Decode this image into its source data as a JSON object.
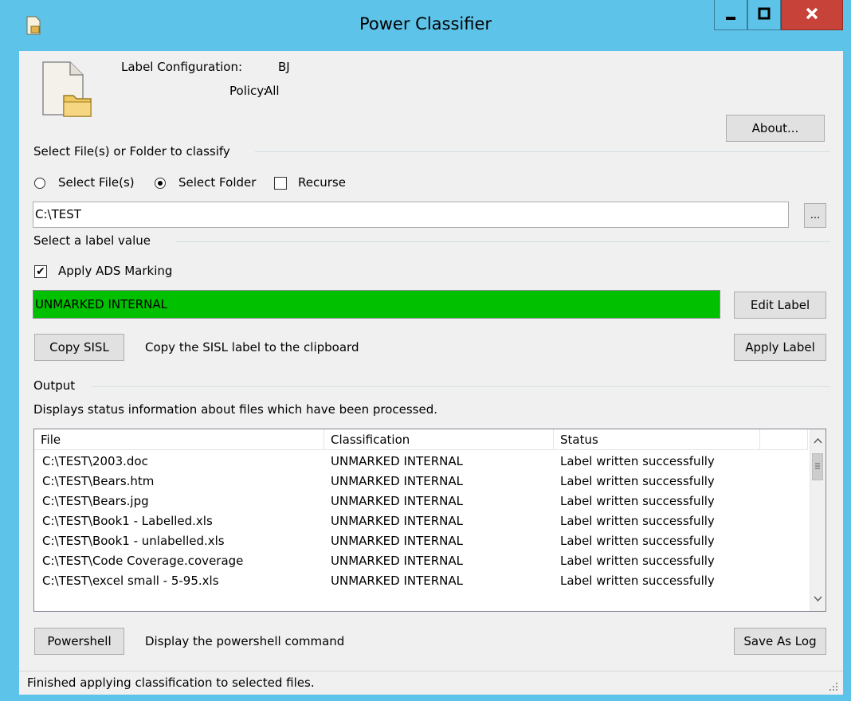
{
  "window": {
    "title": "Power Classifier"
  },
  "info": {
    "label_config_label": "Label Configuration:",
    "label_config_value": "BJ",
    "policy_label": "Policy:",
    "policy_value": "All"
  },
  "buttons": {
    "about": "About...",
    "browse": "...",
    "edit_label": "Edit Label",
    "copy_sisl": "Copy SISL",
    "apply_label": "Apply Label",
    "powershell": "Powershell",
    "save_as_log": "Save As Log"
  },
  "select_section": {
    "heading": "Select File(s) or Folder to classify",
    "radio_files": "Select File(s)",
    "radio_folder": "Select Folder",
    "recurse": "Recurse",
    "path_value": "C:\\TEST"
  },
  "label_section": {
    "heading": "Select a label value",
    "apply_ads": "Apply ADS Marking",
    "label_value": "UNMARKED INTERNAL",
    "label_color": "#00c000",
    "copy_sisl_desc": "Copy the SISL label to the clipboard"
  },
  "output": {
    "heading": "Output",
    "description": "Displays status information about files which have been processed.",
    "columns": [
      "File",
      "Classification",
      "Status"
    ],
    "rows": [
      [
        "C:\\TEST\\2003.doc",
        "UNMARKED INTERNAL",
        "Label written successfully"
      ],
      [
        "C:\\TEST\\Bears.htm",
        "UNMARKED INTERNAL",
        "Label written successfully"
      ],
      [
        "C:\\TEST\\Bears.jpg",
        "UNMARKED INTERNAL",
        "Label written successfully"
      ],
      [
        "C:\\TEST\\Book1 - Labelled.xls",
        "UNMARKED INTERNAL",
        "Label written successfully"
      ],
      [
        "C:\\TEST\\Book1 - unlabelled.xls",
        "UNMARKED INTERNAL",
        "Label written successfully"
      ],
      [
        "C:\\TEST\\Code Coverage.coverage",
        "UNMARKED INTERNAL",
        "Label written successfully"
      ],
      [
        "C:\\TEST\\excel small - 5-95.xls",
        "UNMARKED INTERNAL",
        "Label written successfully"
      ]
    ]
  },
  "powershell_desc": "Display the powershell command",
  "status_text": "Finished applying classification to selected files."
}
